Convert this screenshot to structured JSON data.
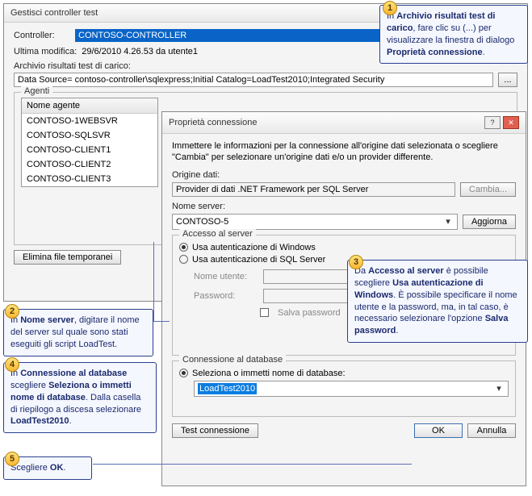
{
  "main": {
    "title": "Gestisci controller test",
    "controller_label": "Controller:",
    "controller_value": "CONTOSO-CONTROLLER",
    "last_modified_label": "Ultima modifica:",
    "last_modified_value": "29/6/2010 4.26.53 da utente1",
    "archive_label": "Archivio risultati test di carico:",
    "data_source": "Data Source= contoso-controller\\sqlexpress;Initial Catalog=LoadTest2010;Integrated Security",
    "ellipsis": "...",
    "agents_legend": "Agenti",
    "agent_header": "Nome agente",
    "agents": [
      "CONTOSO-1WEBSVR",
      "CONTOSO-SQLSVR",
      "CONTOSO-CLIENT1",
      "CONTOSO-CLIENT2",
      "CONTOSO-CLIENT3"
    ],
    "delete_temp": "Elimina file temporanei"
  },
  "dialog": {
    "title": "Proprietà connessione",
    "intro": "Immettere le informazioni per la connessione all'origine dati selezionata o scegliere \"Cambia\" per selezionare un'origine dati e/o un provider differente.",
    "origin_label": "Origine dati:",
    "origin_value": "Provider di dati .NET Framework per SQL Server",
    "change_btn": "Cambia...",
    "server_label": "Nome server:",
    "server_value": "CONTOSO-5",
    "refresh_btn": "Aggiorna",
    "access_legend": "Accesso al server",
    "radio_windows": "Usa autenticazione di Windows",
    "radio_sql": "Usa autenticazione di SQL Server",
    "username_label": "Nome utente:",
    "password_label": "Password:",
    "save_pw": "Salva password",
    "db_legend": "Connessione al database",
    "db_radio": "Seleziona o immetti nome di database:",
    "db_value": "LoadTest2010",
    "test_conn": "Test connessione",
    "ok": "OK",
    "cancel": "Annulla"
  },
  "callouts": {
    "c1": {
      "num": "1",
      "html": "In <b>Archivio risultati test di carico</b>, fare clic su (...) per visualizzare la finestra di dialogo <b>Proprietà connessione</b>."
    },
    "c2": {
      "num": "2",
      "html": "In <b>Nome server</b>, digitare il nome del server sul quale sono stati eseguiti gli script LoadTest."
    },
    "c3": {
      "num": "3",
      "html": "Da <b>Accesso al server</b> è possibile scegliere <b>Usa autenticazione di Windows</b>. È possibile specificare il nome utente e la password, ma, in tal caso, è necessario selezionare l'opzione <b>Salva password</b>."
    },
    "c4": {
      "num": "4",
      "html": "In <b>Connessione al database</b> scegliere <b>Seleziona o immetti nome di database</b>. Dalla casella di riepilogo a discesa selezionare <b>LoadTest2010</b>."
    },
    "c5": {
      "num": "5",
      "html": "Scegliere <b>OK</b>."
    }
  }
}
